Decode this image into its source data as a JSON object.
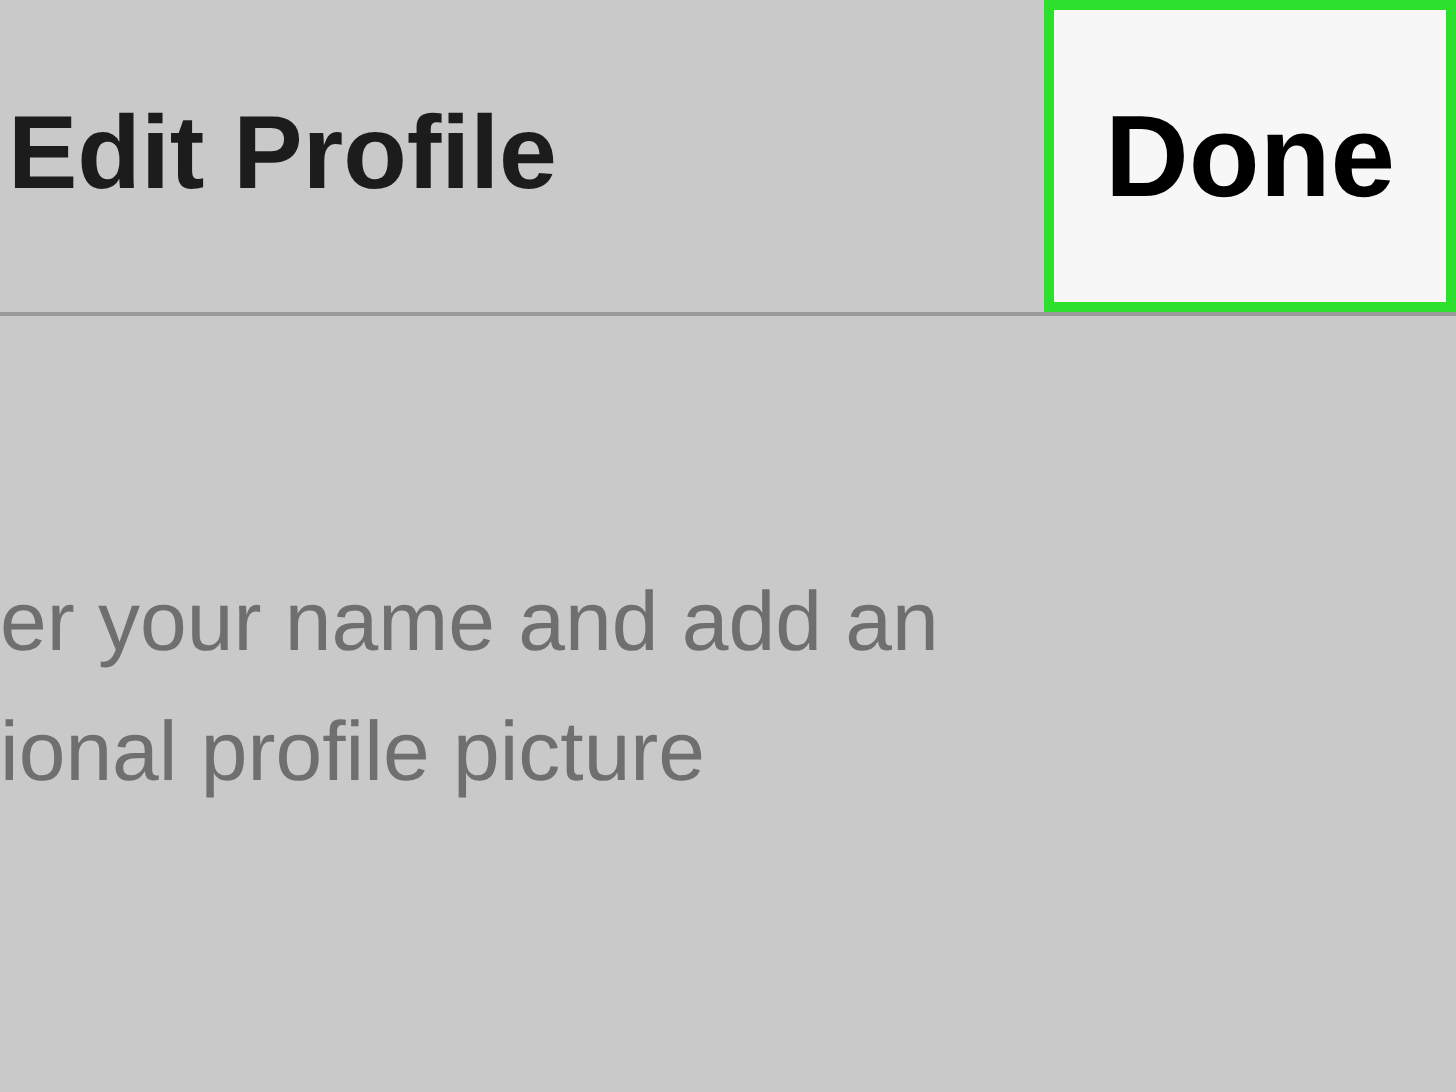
{
  "header": {
    "title": "Edit Profile",
    "done_button": {
      "label": "Done",
      "highlighted": true
    }
  },
  "instructions": [
    "er your name and add an",
    "ional profile picture"
  ]
}
